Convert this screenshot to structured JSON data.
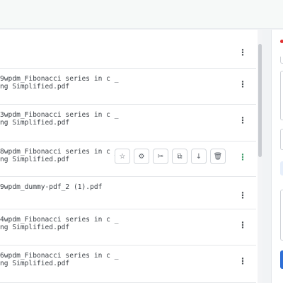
{
  "files": [
    {
      "line1": "9wpdm_Fibonacci series in c _",
      "line2": "ng Simplified.pdf"
    },
    {
      "line1": "3wpdm_Fibonacci series in c _",
      "line2": "ng Simplified.pdf"
    },
    {
      "line1": "8wpdm_Fibonacci series in c _",
      "line2": "ng Simplified.pdf"
    },
    {
      "line1": "9wpdm_dummy-pdf_2 (1).pdf",
      "line2": ""
    },
    {
      "line1": "4wpdm_Fibonacci series in c _",
      "line2": "ng Simplified.pdf"
    },
    {
      "line1": "6wpdm_Fibonacci series in c _",
      "line2": "ng Simplified.pdf"
    }
  ],
  "row_menu_glyph": "⋮",
  "hover_toolbar": [
    {
      "icon": "star-icon",
      "glyph": "☆"
    },
    {
      "icon": "gear-icon",
      "glyph": "⚙"
    },
    {
      "icon": "scissors-icon",
      "glyph": "✂"
    },
    {
      "icon": "copy-icon",
      "glyph": "⧉"
    },
    {
      "icon": "download-icon",
      "glyph": "↓"
    },
    {
      "icon": "trash-icon",
      "glyph": "🗑"
    }
  ],
  "colors": {
    "accent": "#2f6fd6",
    "kebab_active": "#3a9a66",
    "error": "#e03131"
  }
}
